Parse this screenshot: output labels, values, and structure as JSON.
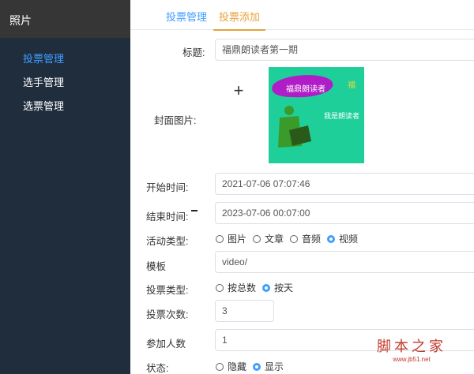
{
  "sidebar": {
    "title": "照片",
    "items": [
      {
        "label": "投票管理",
        "active": true
      },
      {
        "label": "选手管理",
        "active": false
      },
      {
        "label": "选票管理",
        "active": false
      }
    ]
  },
  "tabs": [
    {
      "label": "投票管理",
      "active": false
    },
    {
      "label": "投票添加",
      "active": true
    }
  ],
  "form": {
    "title": {
      "label": "标题:",
      "value": "福鼎朗读者第一期"
    },
    "cover": {
      "label": "封面图片:",
      "upload_glyph": "+",
      "image_text_1": "福鼎朗读者",
      "image_text_2": "我是朗读者",
      "image_text_3": "福"
    },
    "start": {
      "label": "开始时间:",
      "value": "2021-07-06 07:07:46"
    },
    "end": {
      "label": "结束时间:",
      "value": "2023-07-06 00:07:00"
    },
    "activity_type": {
      "label": "活动类型:",
      "options": [
        "图片",
        "文章",
        "音频",
        "视频"
      ],
      "selected": "视频"
    },
    "template": {
      "label": "模板",
      "value": "video/"
    },
    "vote_type": {
      "label": "投票类型:",
      "options": [
        "按总数",
        "按天"
      ],
      "selected": "按天"
    },
    "vote_count": {
      "label": "投票次数:",
      "value": "3"
    },
    "participants": {
      "label": "参加人数",
      "value": "1"
    },
    "status": {
      "label": "状态:",
      "options": [
        "隐藏",
        "显示"
      ],
      "selected": "显示"
    }
  },
  "watermark": {
    "main": "脚本之家",
    "sub": "www.jb51.net"
  },
  "colors": {
    "sidebar_bg": "#1f2d3d",
    "accent": "#409eff",
    "tab_active": "#e6a23c",
    "cover_bg": "#1fcf9a"
  }
}
